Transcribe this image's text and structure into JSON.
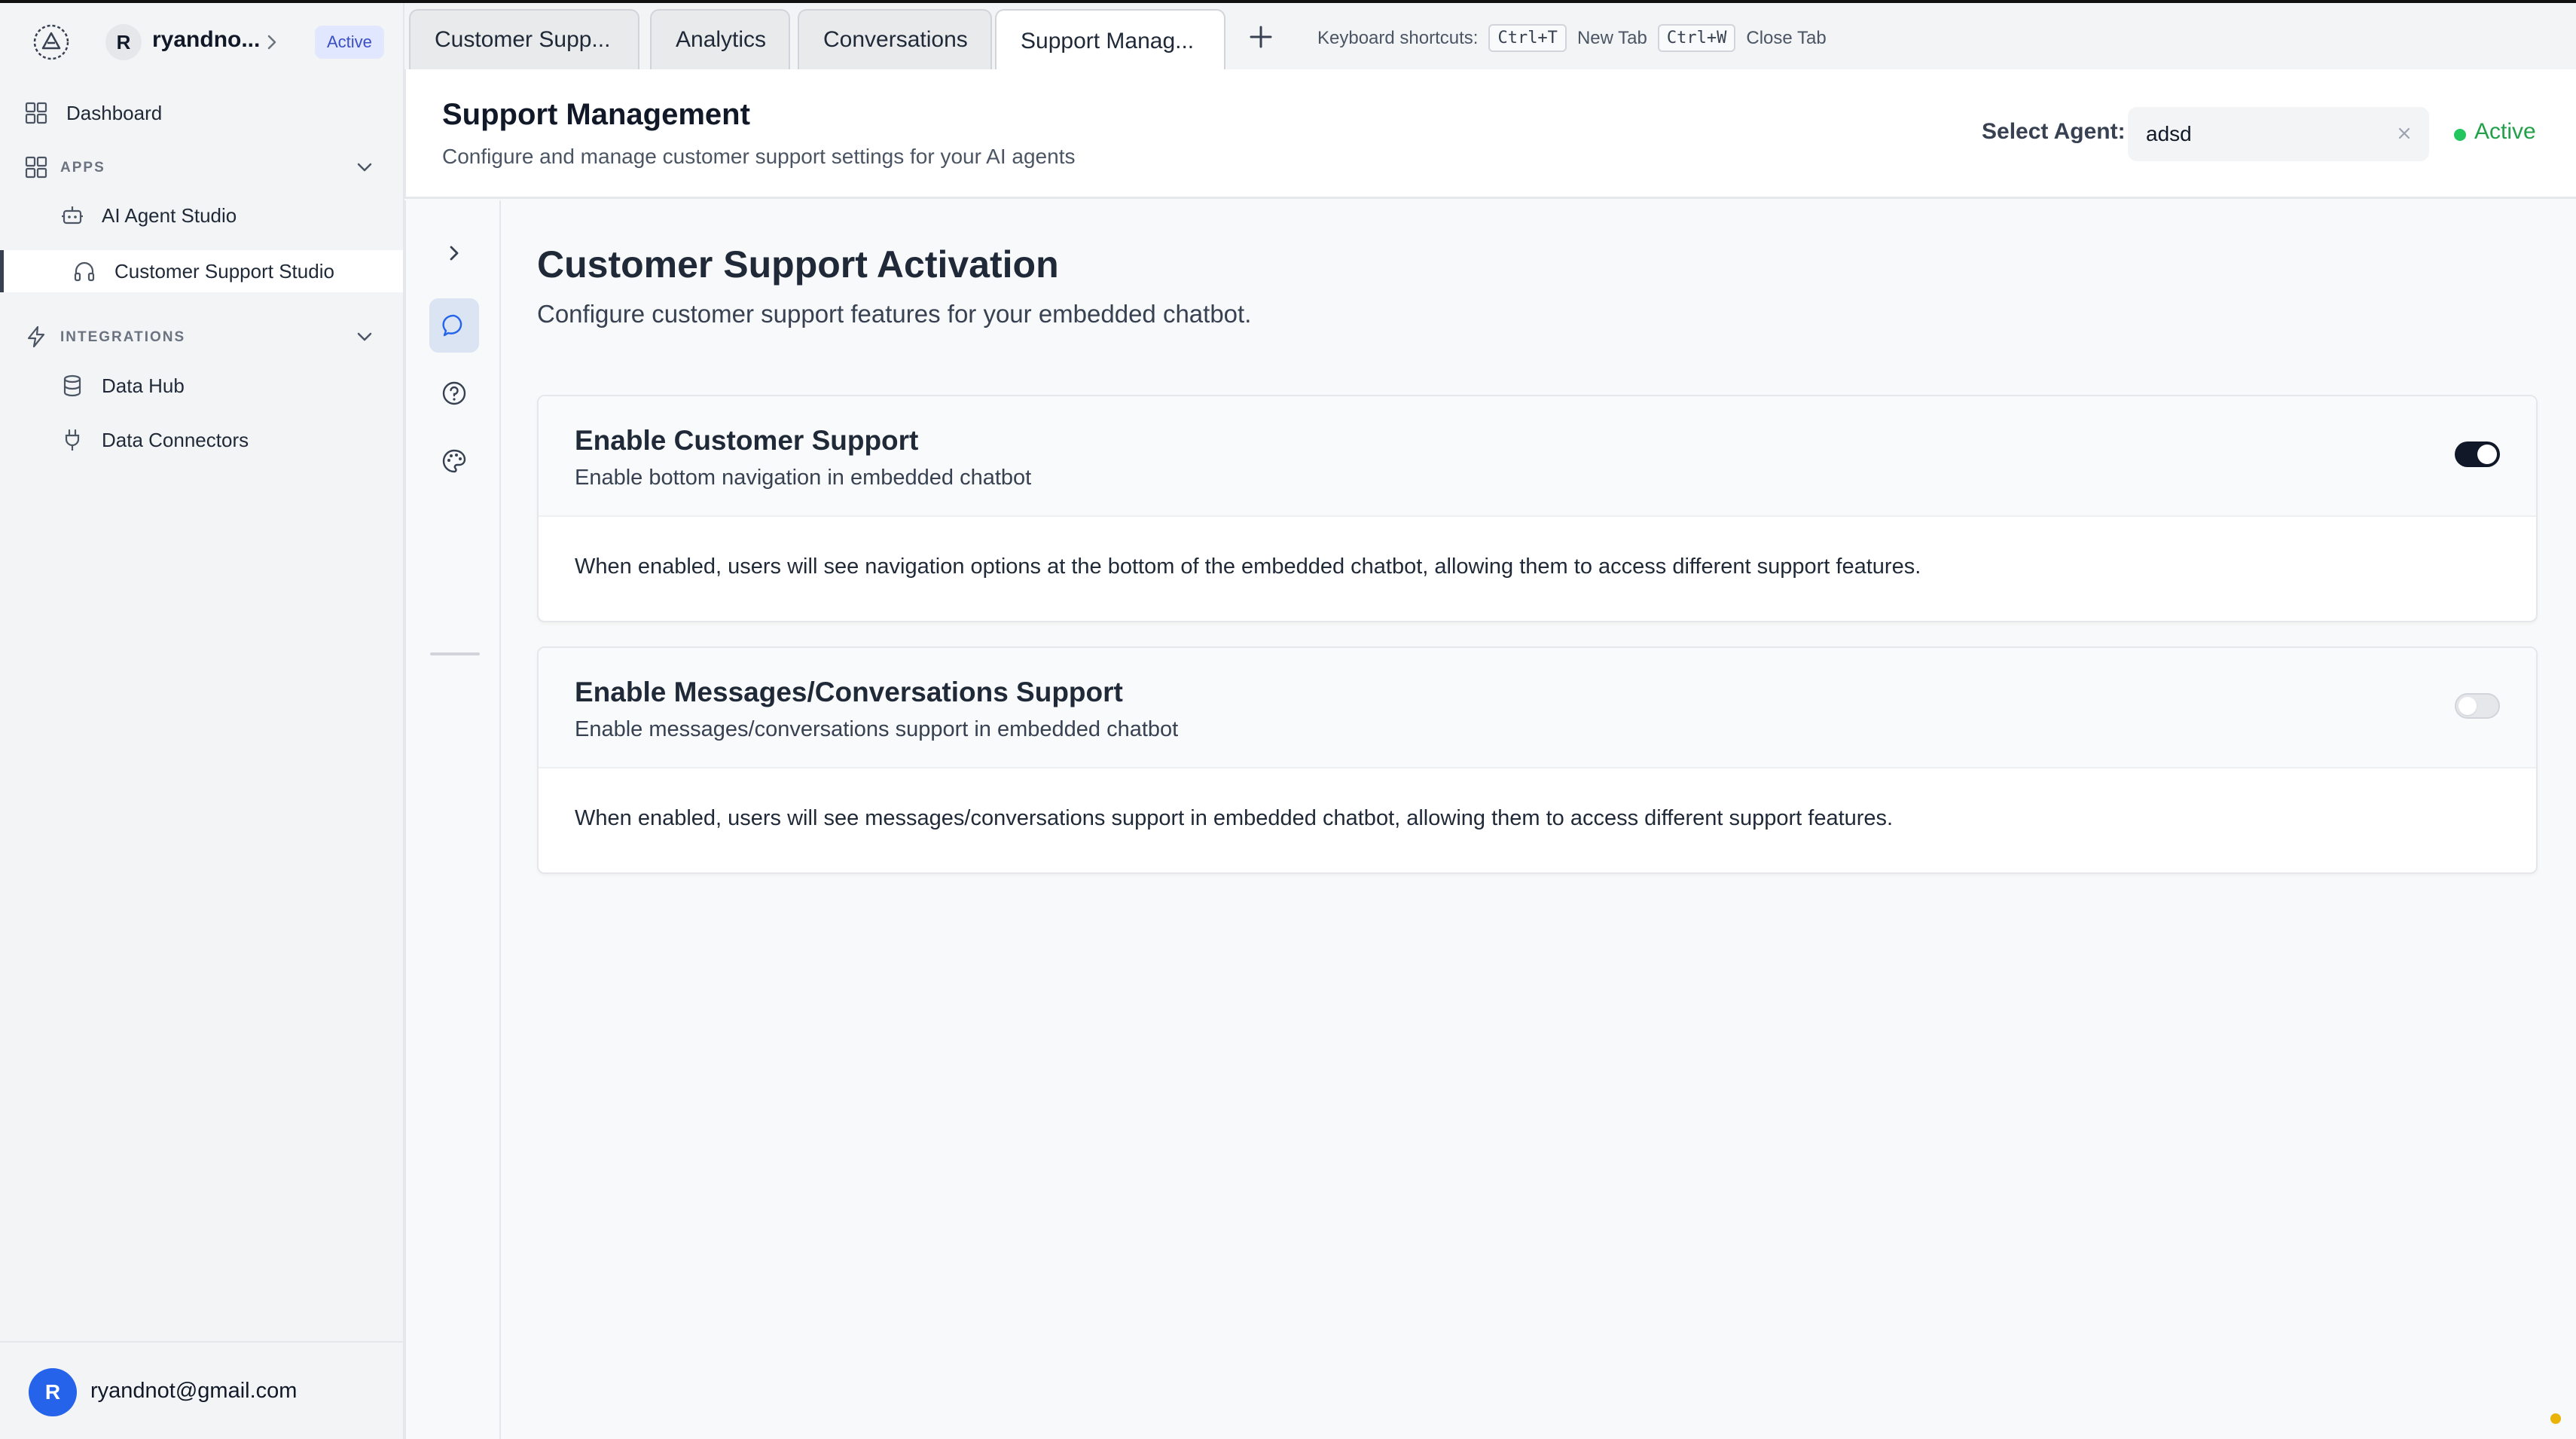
{
  "workspace": {
    "avatar_letter": "R",
    "name": "ryandno...",
    "badge": "Active"
  },
  "sidebar": {
    "dashboard": "Dashboard",
    "apps_section": "APPS",
    "apps": [
      {
        "label": "AI Agent Studio",
        "icon": "robot-icon"
      },
      {
        "label": "Customer Support Studio",
        "icon": "headphones-icon",
        "active": true
      }
    ],
    "integrations_section": "INTEGRATIONS",
    "integrations": [
      {
        "label": "Data Hub",
        "icon": "database-icon"
      },
      {
        "label": "Data Connectors",
        "icon": "plug-icon"
      }
    ],
    "user": {
      "avatar_letter": "R",
      "email": "ryandnot@gmail.com"
    }
  },
  "tabs": [
    {
      "label": "Customer Supp..."
    },
    {
      "label": "Analytics"
    },
    {
      "label": "Conversations"
    },
    {
      "label": "Support Manag...",
      "active": true
    }
  ],
  "shortcuts": {
    "label": "Keyboard shortcuts:",
    "new_key": "Ctrl+T",
    "new_label": "New Tab",
    "close_key": "Ctrl+W",
    "close_label": "Close Tab"
  },
  "header": {
    "title": "Support Management",
    "subtitle": "Configure and manage customer support settings for your AI agents",
    "agent_label": "Select Agent:",
    "agent_value": "adsd",
    "status": "Active"
  },
  "content": {
    "title": "Customer Support Activation",
    "description": "Configure customer support features for your embedded chatbot.",
    "cards": [
      {
        "title": "Enable Customer Support",
        "subtitle": "Enable bottom navigation in embedded chatbot",
        "body": "When enabled, users will see navigation options at the bottom of the embedded chatbot, allowing them to access different support features.",
        "enabled": true
      },
      {
        "title": "Enable Messages/Conversations Support",
        "subtitle": "Enable messages/conversations support in embedded chatbot",
        "body": "When enabled, users will see messages/conversations support in embedded chatbot, allowing them to access different support features.",
        "enabled": false
      }
    ]
  },
  "colors": {
    "accent": "#2563eb",
    "status_green": "#22c55e",
    "toggle_on": "#111827"
  }
}
